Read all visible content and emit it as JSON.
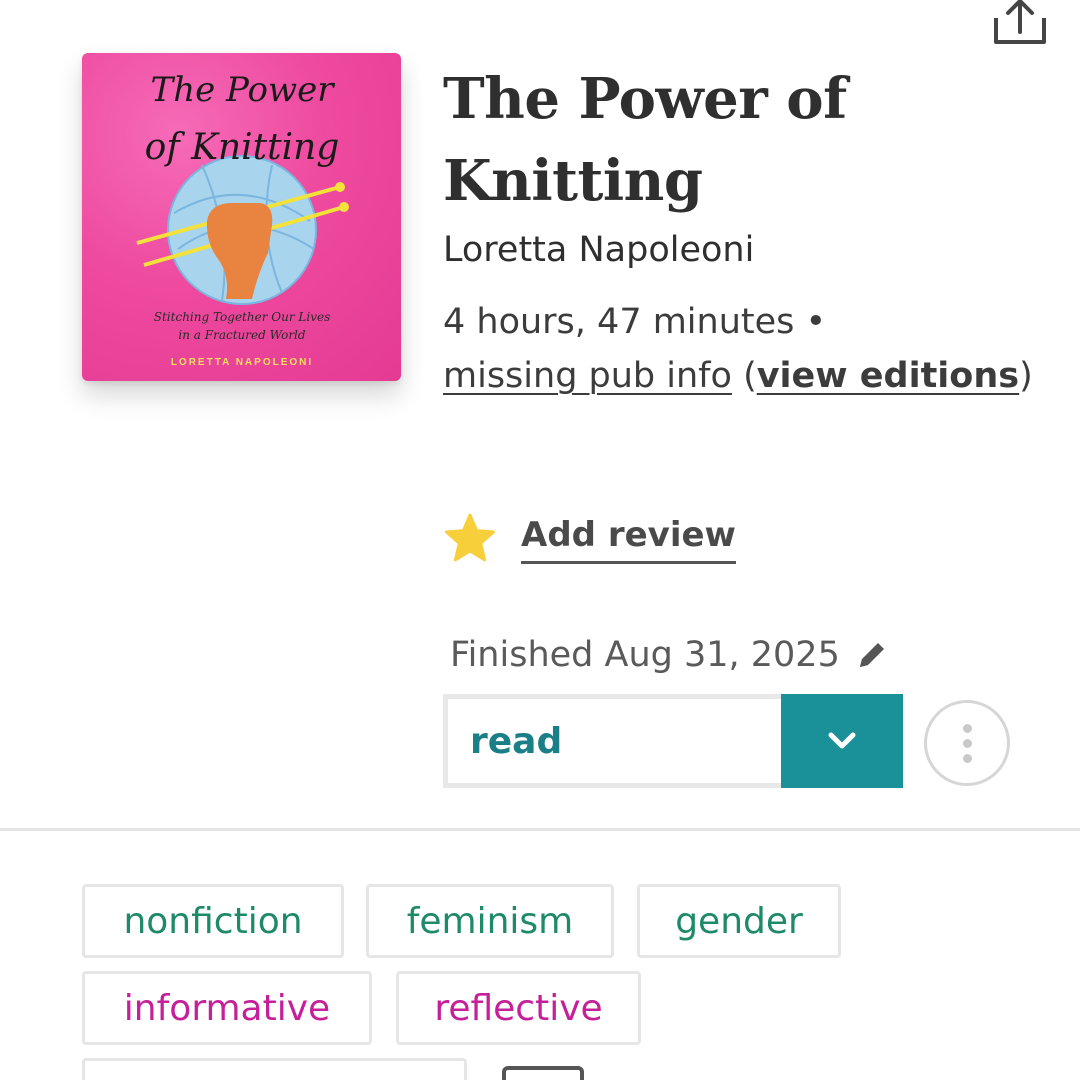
{
  "book": {
    "title": "The Power of Knitting",
    "author": "Loretta Napoleoni",
    "duration": "4 hours, 47 minutes",
    "separator": "•",
    "pub_info": "missing pub info",
    "view_editions": "view editions",
    "cover": {
      "title_line1": "The Power",
      "title_line2": "of Knitting",
      "subtitle_line1": "Stitching Together Our Lives",
      "subtitle_line2": "in a Fractured World",
      "author": "LORETTA NAPOLEONI"
    }
  },
  "review": {
    "label": "Add review",
    "icon": "star-icon"
  },
  "finished": {
    "text": "Finished Aug 31, 2025",
    "icon": "pencil-icon"
  },
  "status": {
    "value": "read",
    "icon": "chevron-down-icon"
  },
  "more": {
    "icon": "more-vertical-icon"
  },
  "share": {
    "icon": "share-icon"
  },
  "tags": {
    "mood_or_genre": [
      "nonfiction",
      "feminism",
      "gender"
    ],
    "tone": [
      "informative",
      "reflective"
    ]
  },
  "colors": {
    "accent_teal": "#1a9199",
    "tag_green": "#1e8a69",
    "tag_pink": "#c5209a",
    "star_yellow": "#f6cf3b",
    "cover_pink": "#ee4a9f"
  }
}
